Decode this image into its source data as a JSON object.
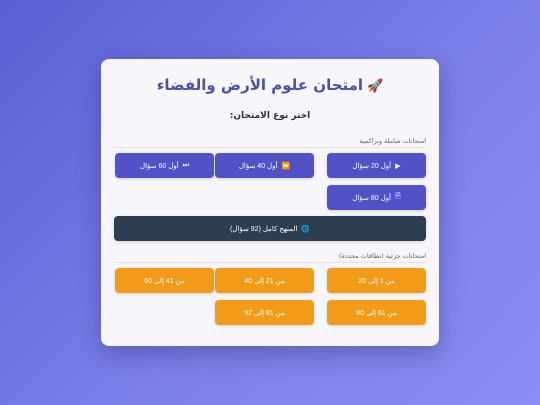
{
  "header": {
    "title": "امتحان علوم الأرض والفضاء",
    "rocket_icon": "rocket-icon"
  },
  "subtitle": "اختر نوع الامتحان:",
  "comprehensive": {
    "label": "امتحانات شاملة وتراكمية",
    "buttons": [
      {
        "icon": "▶",
        "label": "أول 20 سؤال"
      },
      {
        "icon": "⏩",
        "label": "أول 40 سؤال"
      },
      {
        "icon": "⏭",
        "label": "أول 60 سؤال"
      },
      {
        "icon": "🗎",
        "label": "أول 80 سؤال"
      }
    ],
    "full": {
      "icon": "🌐",
      "label": "المنهج كامل (92 سؤال)"
    }
  },
  "partial": {
    "label": "امتحانات جزئية (نطاقات محددة)",
    "buttons": [
      {
        "label": "من 1 إلى 20"
      },
      {
        "label": "من 21 إلى 40"
      },
      {
        "label": "من 41 إلى 60"
      },
      {
        "label": "من 61 إلى 80"
      },
      {
        "label": "من 81 إلى 92"
      }
    ]
  },
  "colors": {
    "accent": "#5252c8",
    "orange": "#f29b18",
    "dark": "#2c3e50"
  }
}
